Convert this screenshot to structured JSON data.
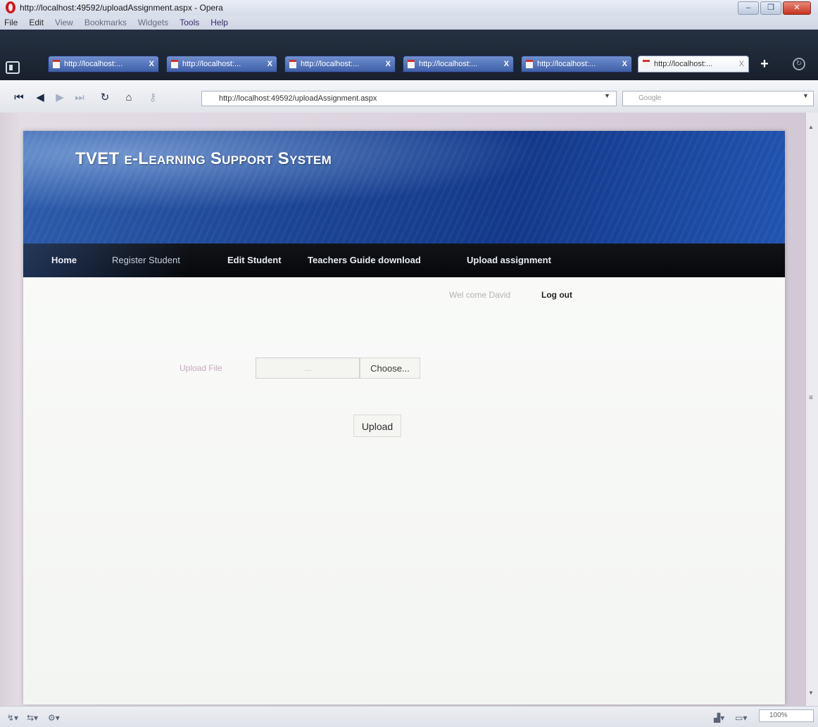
{
  "window": {
    "title": "http://localhost:49592/uploadAssignment.aspx - Opera",
    "controls": {
      "minimize": "–",
      "maximize": "❐",
      "close": "✕"
    }
  },
  "menu": [
    "File",
    "Edit",
    "View",
    "Bookmarks",
    "Widgets",
    "Tools",
    "Help"
  ],
  "tabs": [
    {
      "label": "http://localhost:...",
      "close": "X"
    },
    {
      "label": "http://localhost:...",
      "close": "X"
    },
    {
      "label": "http://localhost:...",
      "close": "X"
    },
    {
      "label": "http://localhost:...",
      "close": "X"
    },
    {
      "label": "http://localhost:...",
      "close": "X"
    },
    {
      "label": "http://localhost:...",
      "close": "X",
      "active": true
    }
  ],
  "tabbar": {
    "new_tab": "+",
    "trash": "↻"
  },
  "toolbar": {
    "url": "http://localhost:49592/uploadAssignment.aspx",
    "search_placeholder": "Google",
    "search_engine": "G",
    "icons": [
      "rewind-icon",
      "back-icon",
      "forward-icon",
      "fast-forward-icon",
      "reload-icon",
      "home-icon",
      "key-icon"
    ]
  },
  "site": {
    "title": "TVET e-Learning Support System",
    "nav": [
      "Home",
      "Register Student",
      "Edit Student",
      "Teachers Guide download",
      "Upload assignment"
    ],
    "welcome_text": "Wel come  David",
    "logout_label": "Log out"
  },
  "upload_form": {
    "label": "Upload File",
    "file_placeholder": "...",
    "choose_label": "Choose...",
    "upload_label": "Upload"
  },
  "statusbar": {
    "zoom": "100%"
  },
  "colors": {
    "header_blue": "#1c4595",
    "nav_black": "#05070a",
    "tab_blue": "#4f6fb8",
    "opera_red": "#d4141b"
  }
}
